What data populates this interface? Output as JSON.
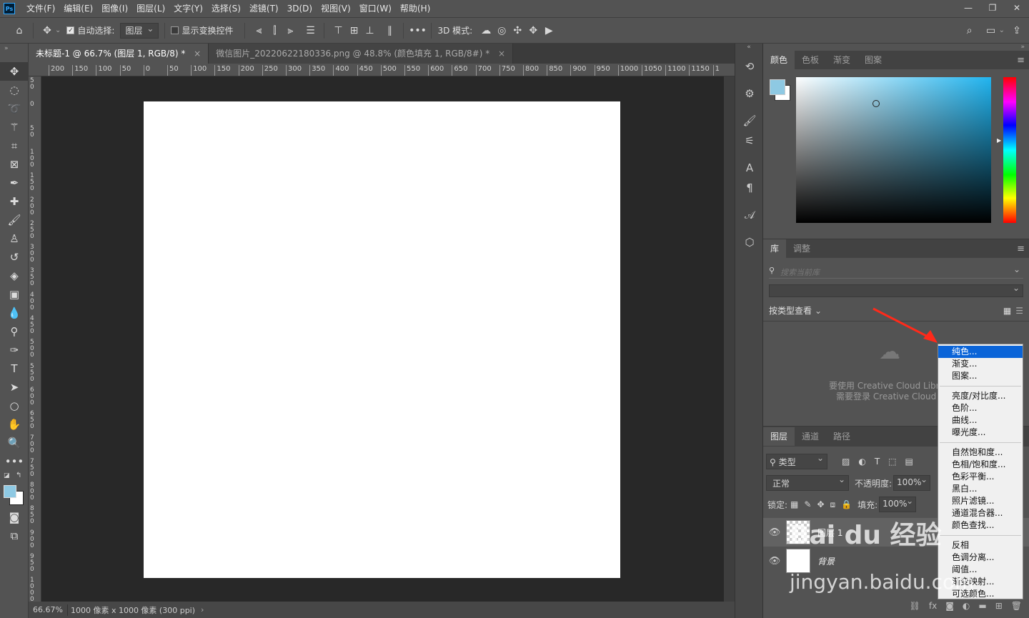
{
  "menubar": {
    "logo": "Ps",
    "items": [
      "文件(F)",
      "编辑(E)",
      "图像(I)",
      "图层(L)",
      "文字(Y)",
      "选择(S)",
      "滤镜(T)",
      "3D(D)",
      "视图(V)",
      "窗口(W)",
      "帮助(H)"
    ]
  },
  "options": {
    "auto_select_label": "自动选择:",
    "auto_select_value": "图层",
    "show_transform_label": "显示变换控件",
    "mode_3d_label": "3D 模式:"
  },
  "tabs": [
    {
      "label": "未标题-1 @ 66.7% (图层 1, RGB/8) *"
    },
    {
      "label": "微信图片_20220622180336.png @ 48.8% (颜色填充 1, RGB/8#) *"
    }
  ],
  "ruler": {
    "h": [
      "200",
      "150",
      "100",
      "50",
      "0",
      "50",
      "100",
      "150",
      "200",
      "250",
      "300",
      "350",
      "400",
      "450",
      "500",
      "550",
      "600",
      "650",
      "700",
      "750",
      "800",
      "850",
      "900",
      "950",
      "1000",
      "1050",
      "1100",
      "1150",
      "1"
    ],
    "v": [
      "50",
      "0",
      "50",
      "100",
      "150",
      "200",
      "250",
      "300",
      "350",
      "400",
      "450",
      "500",
      "550",
      "600",
      "650",
      "700",
      "750",
      "800",
      "850",
      "900",
      "950",
      "1000"
    ]
  },
  "status": {
    "zoom": "66.67%",
    "doc_info": "1000 像素 x 1000 像素 (300 ppi)"
  },
  "color_panel": {
    "tabs": [
      "颜色",
      "色板",
      "渐变",
      "图案"
    ],
    "fg_color": "#8ec9e3",
    "bg_color": "#ffffff"
  },
  "library_panel": {
    "tabs": [
      "库",
      "调整"
    ],
    "search_placeholder": "搜索当前库",
    "view_by": "按类型查看",
    "msg1": "要使用 Creative Cloud Librar",
    "msg2": "需要登录 Creative Cloud 帐"
  },
  "layers_panel": {
    "tabs": [
      "图层",
      "通道",
      "路径"
    ],
    "filter_label": "类型",
    "blend_mode": "正常",
    "opacity_label": "不透明度:",
    "opacity_value": "100%",
    "lock_label": "锁定:",
    "fill_label": "填充:",
    "fill_value": "100%",
    "layers": [
      {
        "name": "图层 1"
      },
      {
        "name": "背景"
      }
    ]
  },
  "popup_menu": {
    "group1": [
      "纯色...",
      "渐变...",
      "图案..."
    ],
    "group2": [
      "亮度/对比度...",
      "色阶...",
      "曲线...",
      "曝光度..."
    ],
    "group3": [
      "自然饱和度...",
      "色相/饱和度...",
      "色彩平衡...",
      "黑白...",
      "照片滤镜...",
      "通道混合器...",
      "颜色查找..."
    ],
    "group4": [
      "反相",
      "色调分离...",
      "阈值...",
      "渐变映射...",
      "可选颜色..."
    ]
  },
  "watermark": {
    "text1": "Bai du 经验",
    "text2": "jingyan.baidu.com"
  }
}
